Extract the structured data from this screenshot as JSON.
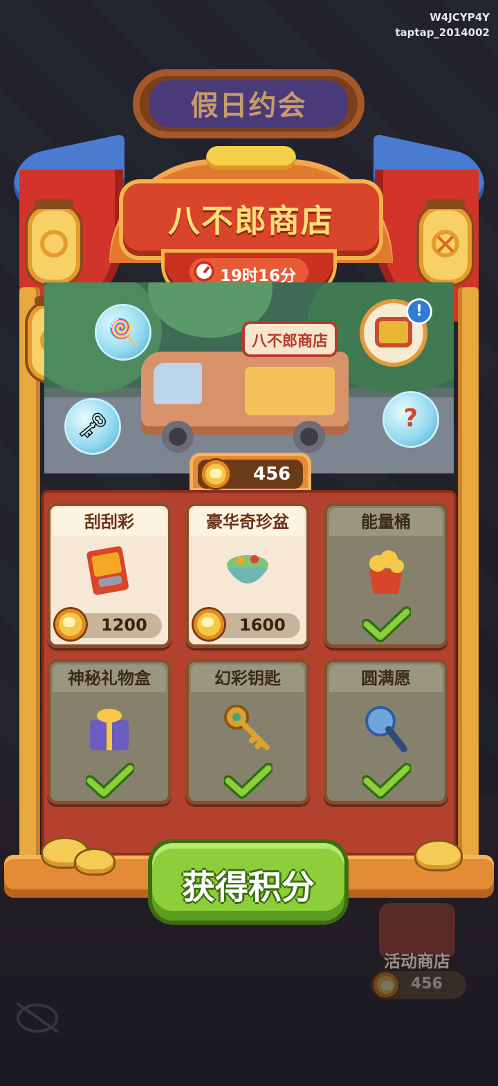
{
  "watermark": {
    "line1": "W4JCYP4Y",
    "line2": "taptap_2014002"
  },
  "background_banner": {
    "title": "假日约会"
  },
  "shop": {
    "title": "八不郎商店",
    "timer": "19时16分",
    "truck_sign": "八不郎商店",
    "balance": "456",
    "colors": {
      "accent": "#d9452a",
      "gold": "#f6c84a",
      "cta": "#8ccf3a"
    }
  },
  "scene_items": [
    {
      "icon": "lollipop-icon"
    },
    {
      "icon": "key-icon"
    },
    {
      "icon": "mystery-card-icon",
      "glyph": "?"
    },
    {
      "icon": "treasure-box-icon",
      "alert": "!"
    }
  ],
  "items": [
    {
      "name": "刮刮彩",
      "price": "1200",
      "owned": false
    },
    {
      "name": "豪华奇珍盆",
      "price": "1600",
      "owned": false
    },
    {
      "name": "能量桶",
      "owned": true
    },
    {
      "name": "神秘礼物盒",
      "owned": true
    },
    {
      "name": "幻彩钥匙",
      "owned": true
    },
    {
      "name": "圆满愿",
      "owned": true
    }
  ],
  "cta": {
    "label": "获得积分"
  },
  "event_shop": {
    "label": "活动商店",
    "balance": "456"
  }
}
